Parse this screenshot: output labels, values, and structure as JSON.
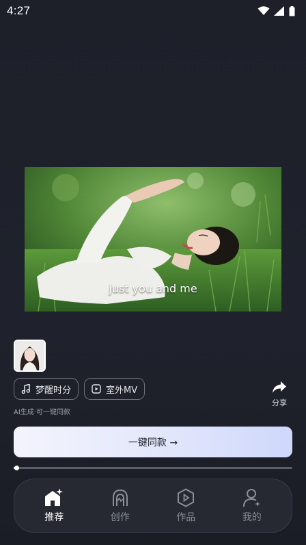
{
  "status_bar": {
    "time": "4:27",
    "icons": [
      "wifi-icon",
      "cellular-signal-icon",
      "battery-icon"
    ]
  },
  "video": {
    "lyric": "just you and me"
  },
  "creator": {
    "avatar_icon": "creator-avatar"
  },
  "tags": [
    {
      "icon": "music-note-icon",
      "label": "梦醒时分"
    },
    {
      "icon": "video-play-icon",
      "label": "室外MV"
    }
  ],
  "ai_note": "AI生成·可一键同款",
  "share": {
    "icon": "share-icon",
    "label": "分享"
  },
  "action": {
    "label": "一键同款 →"
  },
  "progress": {
    "fraction": 0.01
  },
  "nav": [
    {
      "icon": "home-sparkle-icon",
      "label": "推荐",
      "active": true
    },
    {
      "icon": "create-icon",
      "label": "创作",
      "active": false
    },
    {
      "icon": "works-play-icon",
      "label": "作品",
      "active": false
    },
    {
      "icon": "profile-icon",
      "label": "我的",
      "active": false
    }
  ],
  "colors": {
    "background": "#1d2029",
    "button_gradient_start": "#f3f4fd",
    "button_gradient_end": "#cfd8fb",
    "nav_inactive": "#8a8f99"
  }
}
